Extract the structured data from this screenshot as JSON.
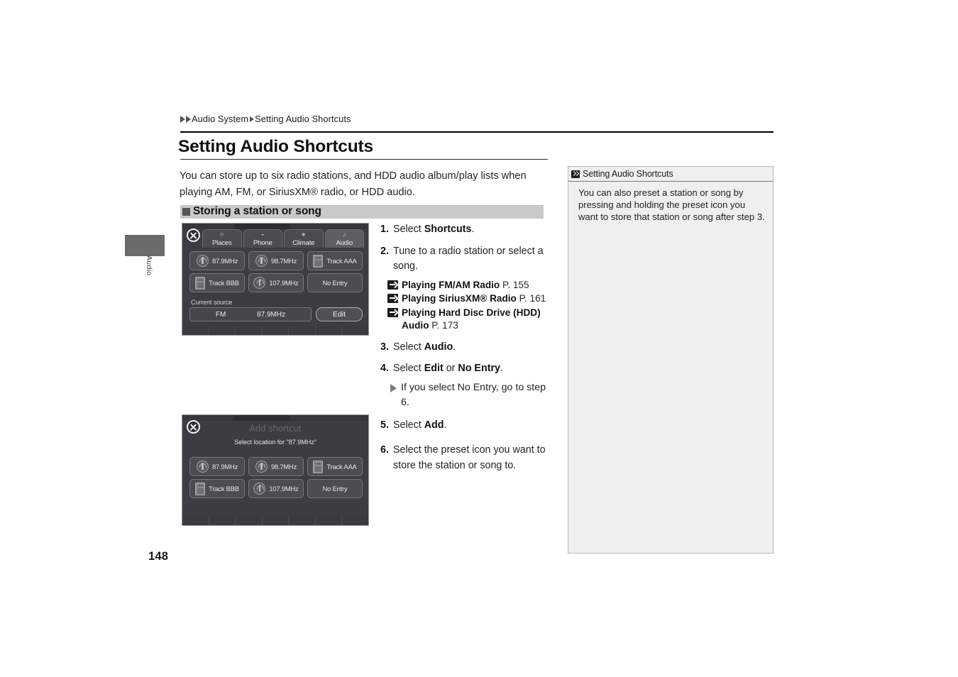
{
  "breadcrumb": {
    "part1": "Audio System",
    "part2": "Setting Audio Shortcuts"
  },
  "page_title": "Setting Audio Shortcuts",
  "intro": "You can store up to six radio stations, and HDD audio album/play lists when playing AM, FM, or SiriusXM® radio, or HDD audio.",
  "section_heading": "Storing a station or song",
  "device_screenshot_1": {
    "close_icon": "close-icon",
    "tabs": [
      {
        "label": "Places",
        "icon": "places-icon",
        "active": false
      },
      {
        "label": "Phone",
        "icon": "phone-icon",
        "active": false
      },
      {
        "label": "Climate",
        "icon": "climate-icon",
        "active": false
      },
      {
        "label": "Audio",
        "icon": "music-note-icon",
        "active": true
      }
    ],
    "presets": [
      {
        "label": "87.9MHz",
        "icon": "radio-icon"
      },
      {
        "label": "98.7MHz",
        "icon": "radio-icon"
      },
      {
        "label": "Track AAA",
        "icon": "hdd-icon"
      },
      {
        "label": "Track BBB",
        "icon": "hdd-icon"
      },
      {
        "label": "107.9MHz",
        "icon": "radio-icon"
      },
      {
        "label": "No Entry",
        "icon": "none"
      }
    ],
    "current_source_label": "Current source",
    "current_source_name": "FM",
    "current_source_value": "87.9MHz",
    "edit_button": "Edit"
  },
  "device_screenshot_2": {
    "close_icon": "close-icon",
    "title": "Add shortcut",
    "subtitle": "Select location for \"87.9MHz\"",
    "presets": [
      {
        "label": "87.9MHz",
        "icon": "radio-icon"
      },
      {
        "label": "98.7MHz",
        "icon": "radio-icon"
      },
      {
        "label": "Track AAA",
        "icon": "hdd-icon"
      },
      {
        "label": "Track BBB",
        "icon": "hdd-icon"
      },
      {
        "label": "107.9MHz",
        "icon": "radio-icon"
      },
      {
        "label": "No Entry",
        "icon": "none"
      }
    ]
  },
  "steps": {
    "s1_num": "1.",
    "s1_pre": "Select ",
    "s1_key": "Shortcuts",
    "s1_post": ".",
    "s2_num": "2.",
    "s2_text": "Tune to a radio station or select a song.",
    "refs": [
      {
        "title": "Playing FM/AM Radio",
        "page": "P. 155"
      },
      {
        "title": "Playing SiriusXM® Radio",
        "page": "P. 161"
      },
      {
        "title": "Playing Hard Disc Drive (HDD) Audio",
        "page": "P. 173"
      }
    ],
    "s3_num": "3.",
    "s3_pre": "Select ",
    "s3_key": "Audio",
    "s3_post": ".",
    "s4_num": "4.",
    "s4_pre": "Select ",
    "s4_key1": "Edit",
    "s4_mid": " or ",
    "s4_key2": "No Entry",
    "s4_post": ".",
    "s4_bullet": "If you select No Entry, go to step 6.",
    "s5_num": "5.",
    "s5_pre": "Select ",
    "s5_key": "Add",
    "s5_post": ".",
    "s6_num": "6.",
    "s6_text": "Select the preset icon you want to store the station or song to."
  },
  "note": {
    "heading": "Setting Audio Shortcuts",
    "body": "You can also preset a station or song by pressing and holding the preset icon you want to store that station or song after step 3."
  },
  "side_tab_label": "Audio",
  "page_number": "148"
}
